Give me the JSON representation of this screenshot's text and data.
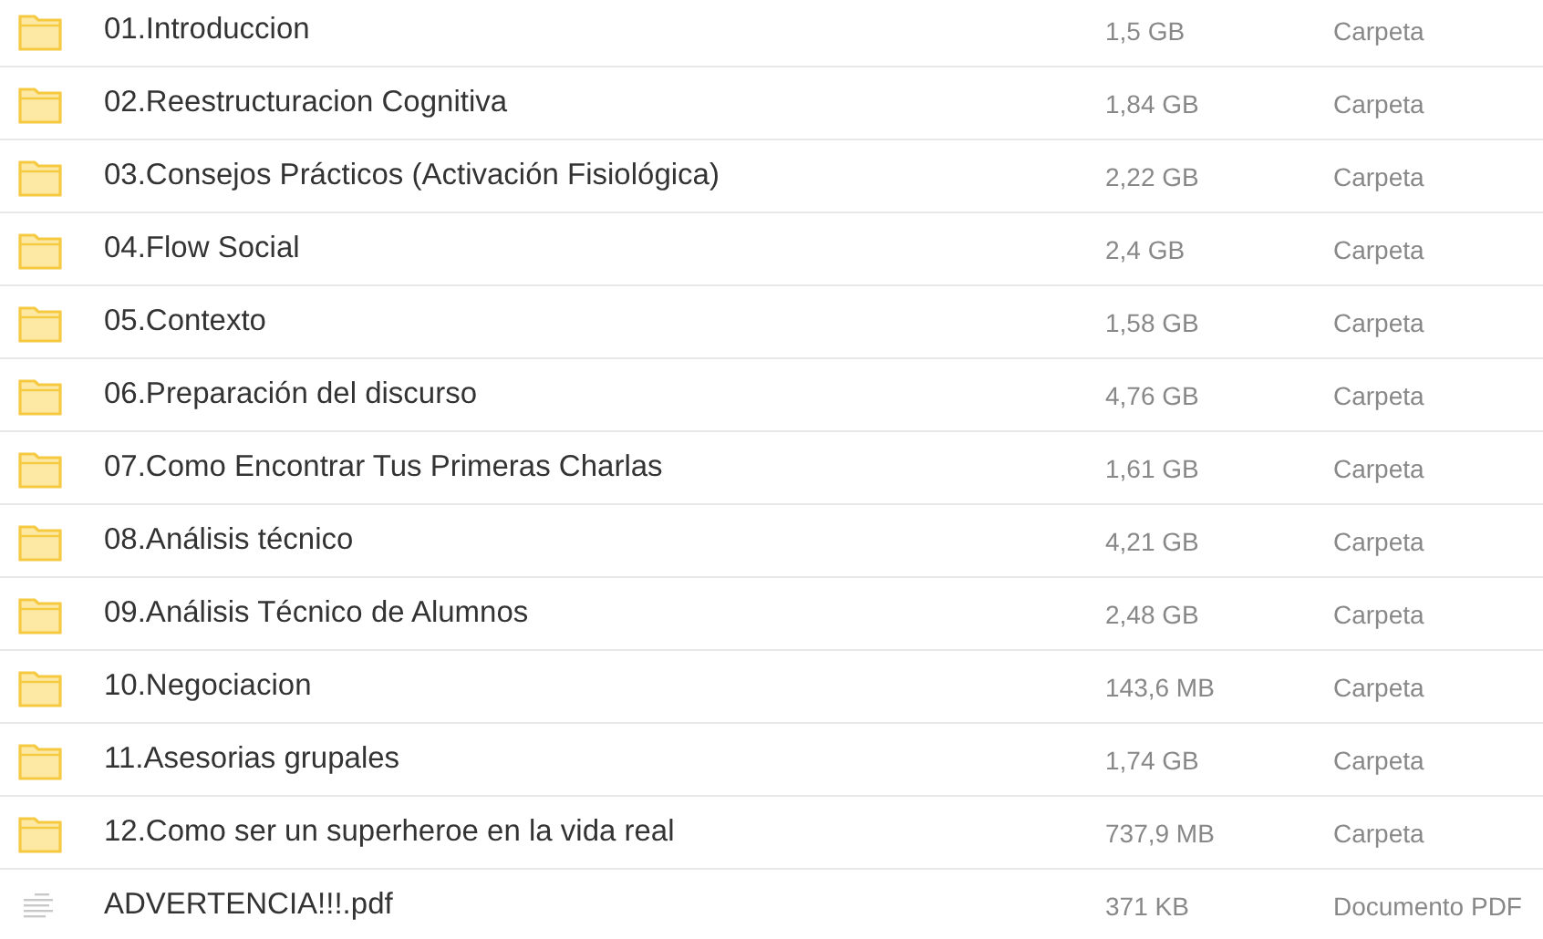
{
  "files": [
    {
      "kind": "folder",
      "name": "01.Introduccion",
      "size": "1,5 GB",
      "type": "Carpeta"
    },
    {
      "kind": "folder",
      "name": "02.Reestructuracion Cognitiva",
      "size": "1,84 GB",
      "type": "Carpeta"
    },
    {
      "kind": "folder",
      "name": "03.Consejos Prácticos (Activación Fisiológica)",
      "size": "2,22 GB",
      "type": "Carpeta"
    },
    {
      "kind": "folder",
      "name": "04.Flow Social",
      "size": "2,4 GB",
      "type": "Carpeta"
    },
    {
      "kind": "folder",
      "name": "05.Contexto",
      "size": "1,58 GB",
      "type": "Carpeta"
    },
    {
      "kind": "folder",
      "name": "06.Preparación del discurso",
      "size": "4,76 GB",
      "type": "Carpeta"
    },
    {
      "kind": "folder",
      "name": "07.Como Encontrar Tus Primeras Charlas",
      "size": "1,61 GB",
      "type": "Carpeta"
    },
    {
      "kind": "folder",
      "name": "08.Análisis técnico",
      "size": "4,21 GB",
      "type": "Carpeta"
    },
    {
      "kind": "folder",
      "name": "09.Análisis Técnico de Alumnos",
      "size": "2,48 GB",
      "type": "Carpeta"
    },
    {
      "kind": "folder",
      "name": "10.Negociacion",
      "size": "143,6 MB",
      "type": "Carpeta"
    },
    {
      "kind": "folder",
      "name": "11.Asesorias grupales",
      "size": "1,74 GB",
      "type": "Carpeta"
    },
    {
      "kind": "folder",
      "name": "12.Como ser un superheroe en la vida real",
      "size": "737,9 MB",
      "type": "Carpeta"
    },
    {
      "kind": "pdf",
      "name": "ADVERTENCIA!!!.pdf",
      "size": "371 KB",
      "type": "Documento PDF"
    }
  ]
}
